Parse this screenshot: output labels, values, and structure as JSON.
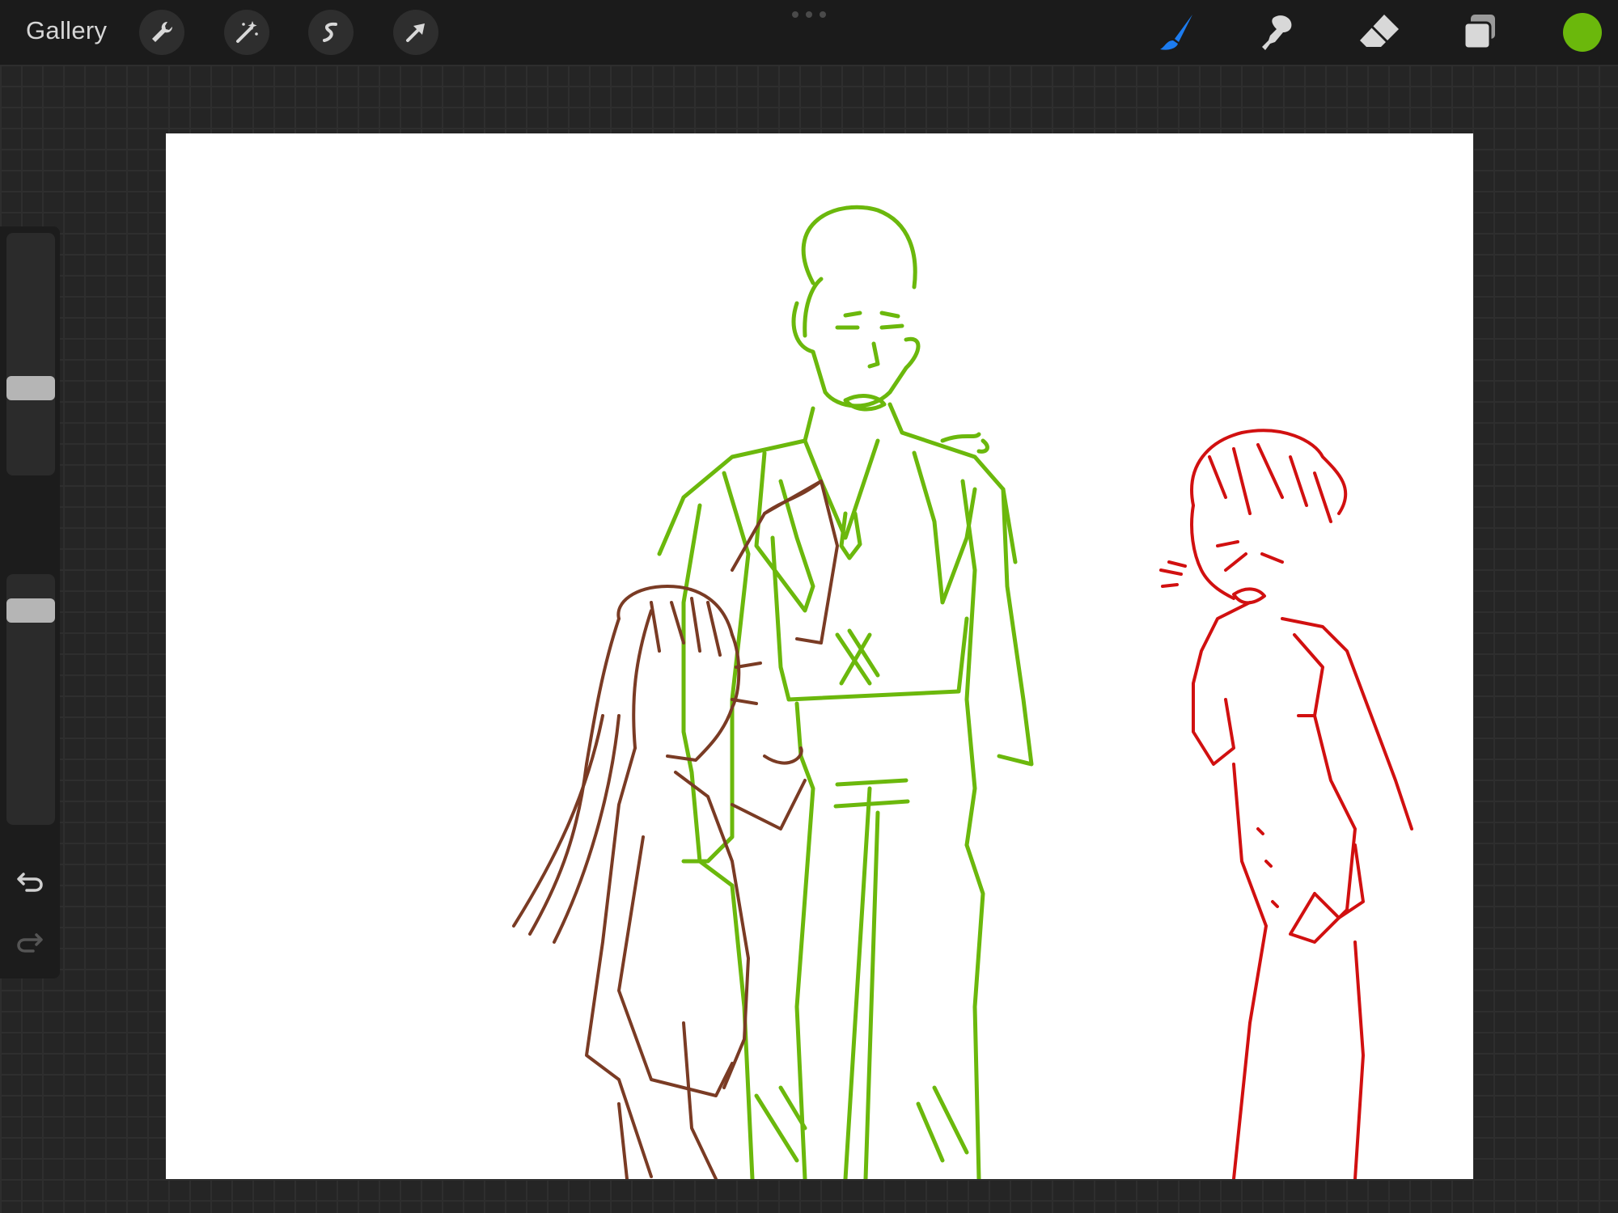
{
  "app": {
    "gallery_label": "Gallery",
    "accent_color": "#6bb80c"
  },
  "toolbar_left": {
    "tools": [
      {
        "icon": "wrench-icon",
        "name": "actions"
      },
      {
        "icon": "magic-wand-icon",
        "name": "adjustments"
      },
      {
        "icon": "selection-icon",
        "name": "selection"
      },
      {
        "icon": "transform-arrow-icon",
        "name": "transform"
      }
    ]
  },
  "toolbar_right": {
    "tools": [
      {
        "icon": "brush-icon",
        "name": "brush",
        "active": true,
        "color": "#1c7cf0"
      },
      {
        "icon": "smudge-icon",
        "name": "smudge"
      },
      {
        "icon": "eraser-icon",
        "name": "eraser"
      },
      {
        "icon": "layers-icon",
        "name": "layers"
      }
    ],
    "current_color": "#6bb80c"
  },
  "sidebar": {
    "brush_size_level": 0.35,
    "brush_opacity_level": 0.93,
    "buttons": [
      "modify-square-icon",
      "undo-icon",
      "redo-icon"
    ]
  },
  "canvas": {
    "content": "sketch",
    "stroke_colors": [
      "#6bb80c",
      "#7a3b24",
      "#d11010"
    ]
  }
}
